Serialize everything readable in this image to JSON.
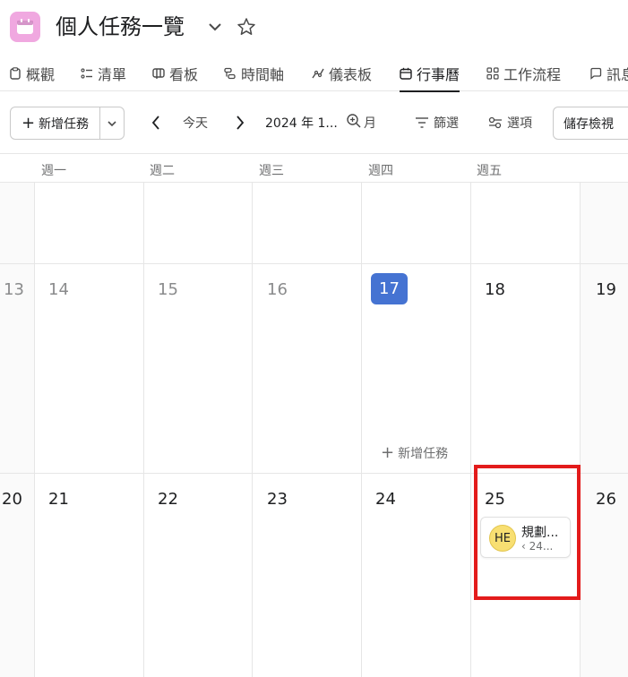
{
  "header": {
    "title": "個人任務一覽",
    "app_icon": "calendar-icon",
    "app_icon_color": "#f0a8e0"
  },
  "tabs": [
    {
      "label": "概觀",
      "icon": "clipboard-icon"
    },
    {
      "label": "清單",
      "icon": "list-icon"
    },
    {
      "label": "看板",
      "icon": "board-icon"
    },
    {
      "label": "時間軸",
      "icon": "timeline-icon"
    },
    {
      "label": "儀表板",
      "icon": "dashboard-icon"
    },
    {
      "label": "行事曆",
      "icon": "calendar-icon",
      "active": true
    },
    {
      "label": "工作流程",
      "icon": "workflow-icon"
    },
    {
      "label": "訊息",
      "icon": "message-icon"
    }
  ],
  "toolbar": {
    "add_task": "新增任務",
    "today": "今天",
    "date_range": "2024 年 1...",
    "view_mode": "月",
    "filter": "篩選",
    "options": "選項",
    "save_view": "儲存檢視"
  },
  "calendar": {
    "weekdays": [
      "週一",
      "週二",
      "週三",
      "週四",
      "週五"
    ],
    "week2": [
      "13",
      "14",
      "15",
      "16",
      "17",
      "18",
      "19"
    ],
    "week3": [
      "20",
      "21",
      "22",
      "23",
      "24",
      "25",
      "26"
    ],
    "today": "17",
    "today_color": "#4573d2",
    "cell_add_task": "新增任務",
    "task": {
      "avatar_initials": "HE",
      "name": "規劃...",
      "subtitle": "‹ 24..."
    }
  },
  "colors": {
    "accent": "#4573d2",
    "highlight": "#e31b1b",
    "avatar": "#f8df72"
  }
}
